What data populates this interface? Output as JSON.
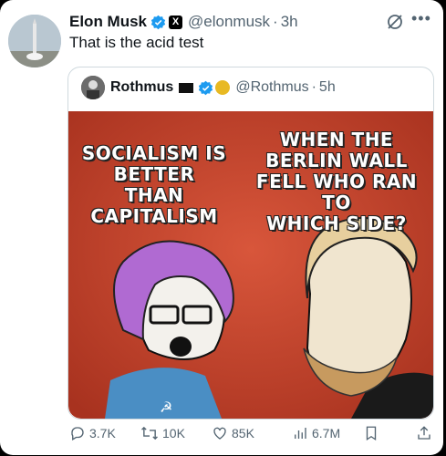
{
  "tweet": {
    "author_name": "Elon Musk",
    "handle": "@elonmusk",
    "time": "3h",
    "text": "That is the acid test",
    "x_badge": "X"
  },
  "quoted": {
    "author_name": "Rothmus",
    "handle": "@Rothmus",
    "time": "5h",
    "meme_left": "SOCIALISM IS\nBETTER THAN\nCAPITALISM",
    "meme_right": "WHEN THE\nBERLIN WALL\nFELL WHO RAN TO\nWHICH SIDE?"
  },
  "actions": {
    "replies": "3.7K",
    "reposts": "10K",
    "likes": "85K",
    "views": "6.7M"
  },
  "icons": [
    "verified-icon",
    "x-badge-icon",
    "grok-icon",
    "more-icon",
    "reply-icon",
    "repost-icon",
    "like-icon",
    "views-icon",
    "bookmark-icon",
    "share-icon"
  ],
  "colors": {
    "verified": "#1d9bf0",
    "muted": "#536471",
    "meme_bg": "#c8472f"
  }
}
